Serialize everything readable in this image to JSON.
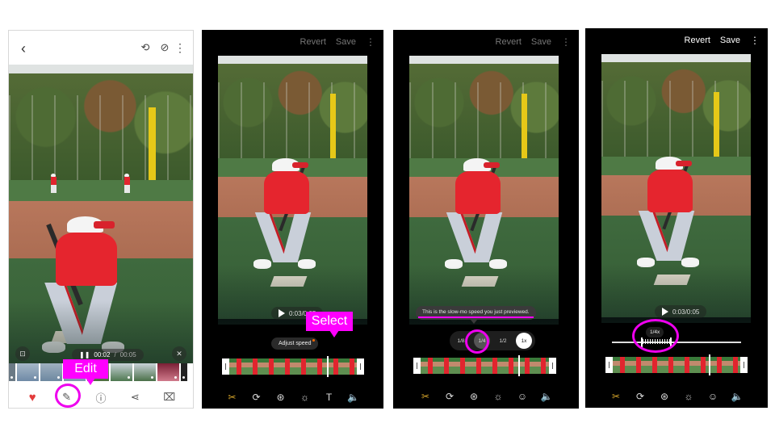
{
  "panel1": {
    "header": {
      "back_icon": "chevron-left-icon",
      "icons": [
        "motion-photo-icon",
        "auto-rotate-icon",
        "more-vert-icon"
      ]
    },
    "video": {
      "elapsed": "00:02",
      "separator": "/",
      "total": "00:05",
      "pause_icon": "pause-icon",
      "capture_icon": "capture-frame-icon",
      "mute_icon": "mute-icon"
    },
    "bottom_bar": [
      {
        "name": "favorite",
        "icon": "heart-icon",
        "glyph": "♥"
      },
      {
        "name": "edit",
        "icon": "pencil-icon",
        "glyph": "✎"
      },
      {
        "name": "details",
        "icon": "info-icon",
        "glyph": "ⓘ"
      },
      {
        "name": "share",
        "icon": "share-icon",
        "glyph": "⋖"
      },
      {
        "name": "delete",
        "icon": "trash-icon",
        "glyph": "🗑"
      }
    ],
    "callout": "Edit",
    "filmstrip_count": 9
  },
  "panel2": {
    "header": {
      "revert": "Revert",
      "save": "Save",
      "more": "⋮"
    },
    "video_time": "0:03/0:05",
    "adjust_speed": "Adjust speed",
    "callout": "Select",
    "tools": [
      {
        "name": "trim",
        "glyph": "✂",
        "active": true
      },
      {
        "name": "transform",
        "glyph": "⟳"
      },
      {
        "name": "filters",
        "glyph": "⊛"
      },
      {
        "name": "adjust",
        "glyph": "☼"
      },
      {
        "name": "text",
        "glyph": "T"
      },
      {
        "name": "audio",
        "glyph": "🔈"
      }
    ]
  },
  "panel3": {
    "header": {
      "revert": "Revert",
      "save": "Save",
      "more": "⋮"
    },
    "tooltip": "This is the slow-mo speed you just previewed.",
    "speeds": [
      "1/8",
      "1/4",
      "1/2",
      "1x"
    ],
    "selected_speed": "1/4",
    "tools": [
      {
        "name": "trim",
        "glyph": "✂",
        "active": true
      },
      {
        "name": "transform",
        "glyph": "⟳"
      },
      {
        "name": "filters",
        "glyph": "⊛"
      },
      {
        "name": "adjust",
        "glyph": "☼"
      },
      {
        "name": "sticker",
        "glyph": "☺"
      },
      {
        "name": "audio",
        "glyph": "🔈"
      }
    ]
  },
  "panel4": {
    "header": {
      "revert": "Revert",
      "save": "Save",
      "more": "⋮"
    },
    "video_time": "0:03/0:05",
    "speed_label": "1/4x",
    "tools": [
      {
        "name": "trim",
        "glyph": "✂",
        "active": true
      },
      {
        "name": "transform",
        "glyph": "⟳"
      },
      {
        "name": "filters",
        "glyph": "⊛"
      },
      {
        "name": "adjust",
        "glyph": "☼"
      },
      {
        "name": "sticker",
        "glyph": "☺"
      },
      {
        "name": "audio",
        "glyph": "🔈"
      }
    ]
  },
  "colors": {
    "highlight": "#ff00ff",
    "active_tool": "#d9a72a",
    "favorite": "#e33b3b"
  }
}
